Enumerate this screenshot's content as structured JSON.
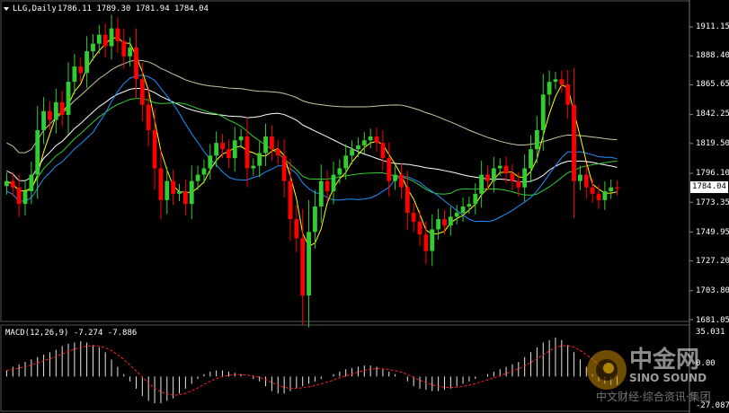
{
  "header": {
    "symbol_text": "LLG,Daily",
    "ohlc_text": "1786.11 1789.30 1781.94 1784.04"
  },
  "price_axis": {
    "labels": [
      "1911.15",
      "1888.40",
      "1865.65",
      "1842.25",
      "1819.50",
      "1796.10",
      "1773.35",
      "1749.95",
      "1727.20",
      "1703.80",
      "1681.05"
    ],
    "current": "1784.04"
  },
  "macd": {
    "label": "MACD(12,26,9) -7.274 -7.886",
    "axis_top": "35.031",
    "axis_mid": "0.00",
    "axis_bottom": "-27.087"
  },
  "watermark": {
    "cn": "中金网",
    "en": "SINO SOUND",
    "sub": "中文财经·综合资讯·集团"
  },
  "chart_data": {
    "type": "candlestick",
    "symbol": "LLG",
    "timeframe": "Daily",
    "ylim": [
      1681.05,
      1911.15
    ],
    "closes": [
      1790,
      1785,
      1772,
      1782,
      1795,
      1830,
      1845,
      1838,
      1852,
      1842,
      1868,
      1880,
      1875,
      1892,
      1898,
      1905,
      1896,
      1910,
      1900,
      1888,
      1895,
      1870,
      1850,
      1830,
      1800,
      1775,
      1790,
      1780,
      1782,
      1772,
      1790,
      1795,
      1800,
      1810,
      1820,
      1815,
      1808,
      1822,
      1825,
      1800,
      1802,
      1812,
      1825,
      1815,
      1810,
      1790,
      1760,
      1745,
      1700,
      1750,
      1770,
      1790,
      1782,
      1795,
      1800,
      1810,
      1815,
      1818,
      1822,
      1825,
      1820,
      1808,
      1790,
      1795,
      1785,
      1765,
      1758,
      1748,
      1735,
      1752,
      1760,
      1755,
      1762,
      1765,
      1770,
      1772,
      1780,
      1795,
      1790,
      1800,
      1802,
      1796,
      1790,
      1785,
      1800,
      1815,
      1830,
      1858,
      1868,
      1870,
      1866,
      1850,
      1790,
      1795,
      1785,
      1780,
      1775,
      1782,
      1785,
      1784
    ],
    "ma_fast_color": "#ffff00",
    "ma_blue_color": "#1e90ff",
    "ma_green_color": "#32cd32",
    "ma_white_color": "#ffffff",
    "ma_slow_color": "#c8c8a0",
    "bull_color": "#32cd32",
    "bear_color": "#ff0000",
    "macd_hist": [
      5,
      8,
      10,
      12,
      14,
      16,
      18,
      20,
      22,
      25,
      27,
      28,
      29,
      28,
      26,
      24,
      20,
      14,
      8,
      2,
      -4,
      -10,
      -16,
      -20,
      -22,
      -22,
      -20,
      -18,
      -14,
      -10,
      -6,
      -2,
      2,
      4,
      5,
      5,
      4,
      3,
      2,
      0,
      -2,
      -4,
      -8,
      -12,
      -14,
      -14,
      -12,
      -10,
      -8,
      -6,
      -4,
      -2,
      0,
      2,
      4,
      6,
      7,
      8,
      9,
      9,
      8,
      6,
      4,
      2,
      0,
      -4,
      -8,
      -10,
      -11,
      -12,
      -12,
      -11,
      -10,
      -8,
      -6,
      -4,
      -2,
      0,
      2,
      4,
      6,
      8,
      10,
      12,
      16,
      20,
      24,
      28,
      30,
      32,
      30,
      26,
      20,
      14,
      8,
      2,
      -4,
      -6,
      -7,
      -7
    ]
  }
}
